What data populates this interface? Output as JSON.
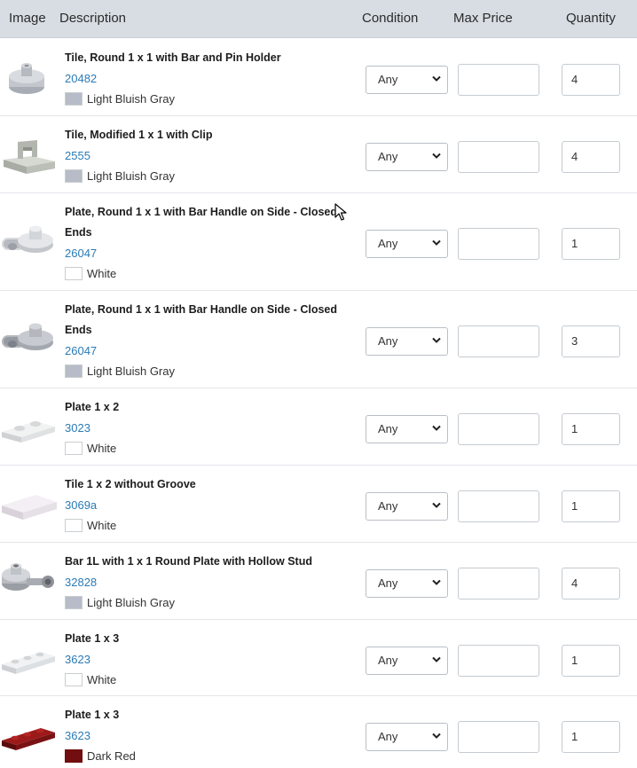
{
  "header": {
    "image": "Image",
    "description": "Description",
    "condition": "Condition",
    "max_price": "Max Price",
    "quantity": "Quantity"
  },
  "rows": [
    {
      "name": "Tile, Round 1 x 1 with Bar and Pin Holder",
      "number": "20482",
      "color": "Light Bluish Gray",
      "color_hex": "#b7bcc8",
      "condition": "Any",
      "max_price": "",
      "quantity": "4",
      "icon": "round-tile-bar-pin-holder-icon"
    },
    {
      "name": "Tile, Modified 1 x 1 with Clip",
      "number": "2555",
      "color": "Light Bluish Gray",
      "color_hex": "#b7bcc8",
      "condition": "Any",
      "max_price": "",
      "quantity": "4",
      "icon": "tile-with-clip-icon"
    },
    {
      "name": "Plate, Round 1 x 1 with Bar Handle on Side - Closed Ends",
      "number": "26047",
      "color": "White",
      "color_hex": "#ffffff",
      "condition": "Any",
      "max_price": "",
      "quantity": "1",
      "icon": "round-plate-bar-handle-icon"
    },
    {
      "name": "Plate, Round 1 x 1 with Bar Handle on Side - Closed Ends",
      "number": "26047",
      "color": "Light Bluish Gray",
      "color_hex": "#b7bcc8",
      "condition": "Any",
      "max_price": "",
      "quantity": "3",
      "icon": "round-plate-bar-handle-icon"
    },
    {
      "name": "Plate 1 x 2",
      "number": "3023",
      "color": "White",
      "color_hex": "#ffffff",
      "condition": "Any",
      "max_price": "",
      "quantity": "1",
      "icon": "plate-1x2-icon"
    },
    {
      "name": "Tile 1 x 2 without Groove",
      "number": "3069a",
      "color": "White",
      "color_hex": "#ffffff",
      "condition": "Any",
      "max_price": "",
      "quantity": "1",
      "icon": "tile-1x2-icon"
    },
    {
      "name": "Bar 1L with 1 x 1 Round Plate with Hollow Stud",
      "number": "32828",
      "color": "Light Bluish Gray",
      "color_hex": "#b7bcc8",
      "condition": "Any",
      "max_price": "",
      "quantity": "4",
      "icon": "bar-round-plate-hollow-stud-icon"
    },
    {
      "name": "Plate 1 x 3",
      "number": "3623",
      "color": "White",
      "color_hex": "#ffffff",
      "condition": "Any",
      "max_price": "",
      "quantity": "1",
      "icon": "plate-1x3-icon"
    },
    {
      "name": "Plate 1 x 3",
      "number": "3623",
      "color": "Dark Red",
      "color_hex": "#720e0f",
      "condition": "Any",
      "max_price": "",
      "quantity": "1",
      "icon": "plate-1x3-icon"
    }
  ],
  "cursor": "mouse-pointer-icon"
}
